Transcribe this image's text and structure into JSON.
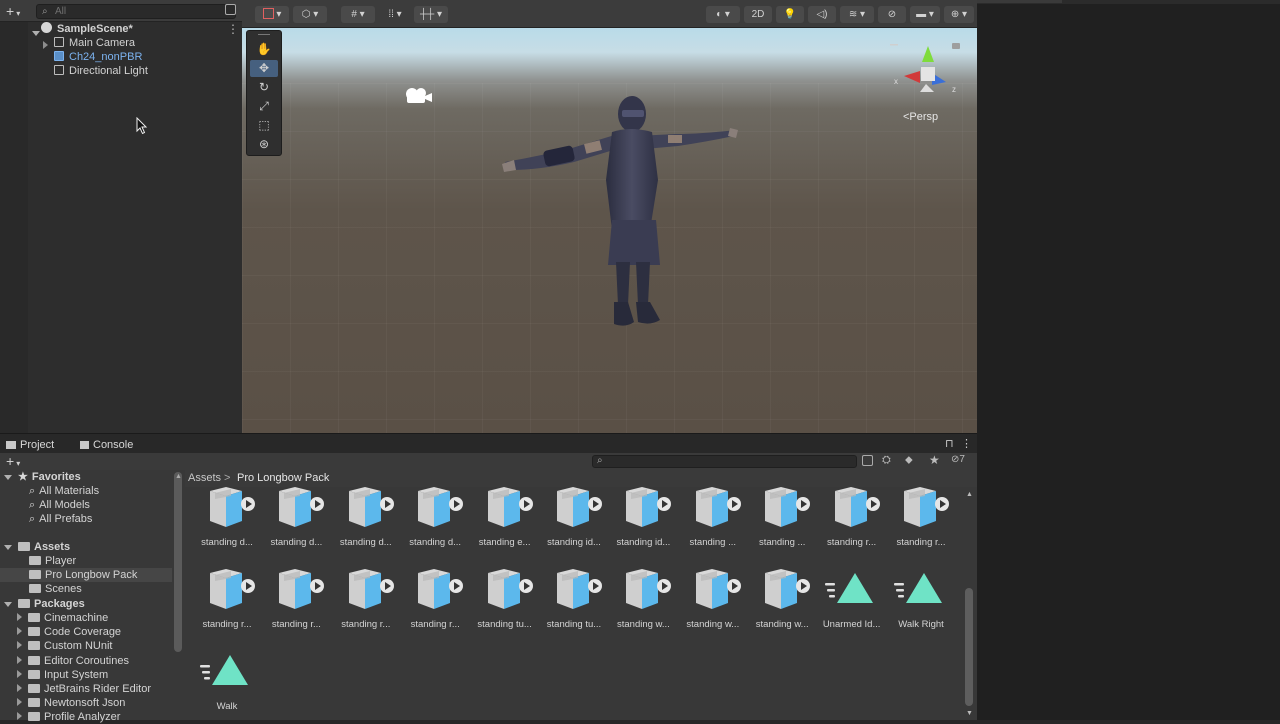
{
  "hierarchy": {
    "search_placeholder": "All",
    "scene_name": "SampleScene*",
    "items": [
      {
        "label": "Main Camera",
        "color": "#d2d2d2"
      },
      {
        "label": "Ch24_nonPBR",
        "color": "#7cb3f0"
      },
      {
        "label": "Directional Light",
        "color": "#d2d2d2"
      }
    ]
  },
  "scene_view": {
    "toolbar": {
      "mode_2d": "2D"
    },
    "perspective_label": "<Persp",
    "gizmo_axes": {
      "x": "x",
      "z": "z"
    }
  },
  "project": {
    "tabs": [
      {
        "label": "Project"
      },
      {
        "label": "Console"
      }
    ],
    "hidden_count": "7",
    "favorites": {
      "label": "Favorites",
      "items": [
        "All Materials",
        "All Models",
        "All Prefabs"
      ]
    },
    "assets": {
      "label": "Assets",
      "items": [
        "Player",
        "Pro Longbow Pack",
        "Scenes"
      ]
    },
    "packages": {
      "label": "Packages",
      "items": [
        "Cinemachine",
        "Code Coverage",
        "Custom NUnit",
        "Editor Coroutines",
        "Input System",
        "JetBrains Rider Editor",
        "Newtonsoft Json",
        "Profile Analyzer"
      ]
    },
    "breadcrumb": {
      "root": "Assets",
      "separator": ">",
      "current": "Pro Longbow Pack"
    },
    "asset_items": [
      {
        "label": "standing d...",
        "kind": "model"
      },
      {
        "label": "standing d...",
        "kind": "model"
      },
      {
        "label": "standing d...",
        "kind": "model"
      },
      {
        "label": "standing d...",
        "kind": "model"
      },
      {
        "label": "standing e...",
        "kind": "model"
      },
      {
        "label": "standing id...",
        "kind": "model"
      },
      {
        "label": "standing id...",
        "kind": "model"
      },
      {
        "label": "standing ...",
        "kind": "model"
      },
      {
        "label": "standing ...",
        "kind": "model"
      },
      {
        "label": "standing r...",
        "kind": "model"
      },
      {
        "label": "standing r...",
        "kind": "model"
      },
      {
        "label": "standing r...",
        "kind": "model"
      },
      {
        "label": "standing r...",
        "kind": "model"
      },
      {
        "label": "standing r...",
        "kind": "model"
      },
      {
        "label": "standing r...",
        "kind": "model"
      },
      {
        "label": "standing tu...",
        "kind": "model"
      },
      {
        "label": "standing tu...",
        "kind": "model"
      },
      {
        "label": "standing w...",
        "kind": "model"
      },
      {
        "label": "standing w...",
        "kind": "model"
      },
      {
        "label": "standing w...",
        "kind": "model"
      },
      {
        "label": "Unarmed Id...",
        "kind": "animation"
      },
      {
        "label": "Walk Right",
        "kind": "animation"
      },
      {
        "label": "Walk",
        "kind": "animation"
      }
    ]
  },
  "colors": {
    "selection": "#7cb3f0",
    "model_icon": "#5cb8ec",
    "animation_icon": "#6fe3c6",
    "selected_row": "#464646"
  }
}
